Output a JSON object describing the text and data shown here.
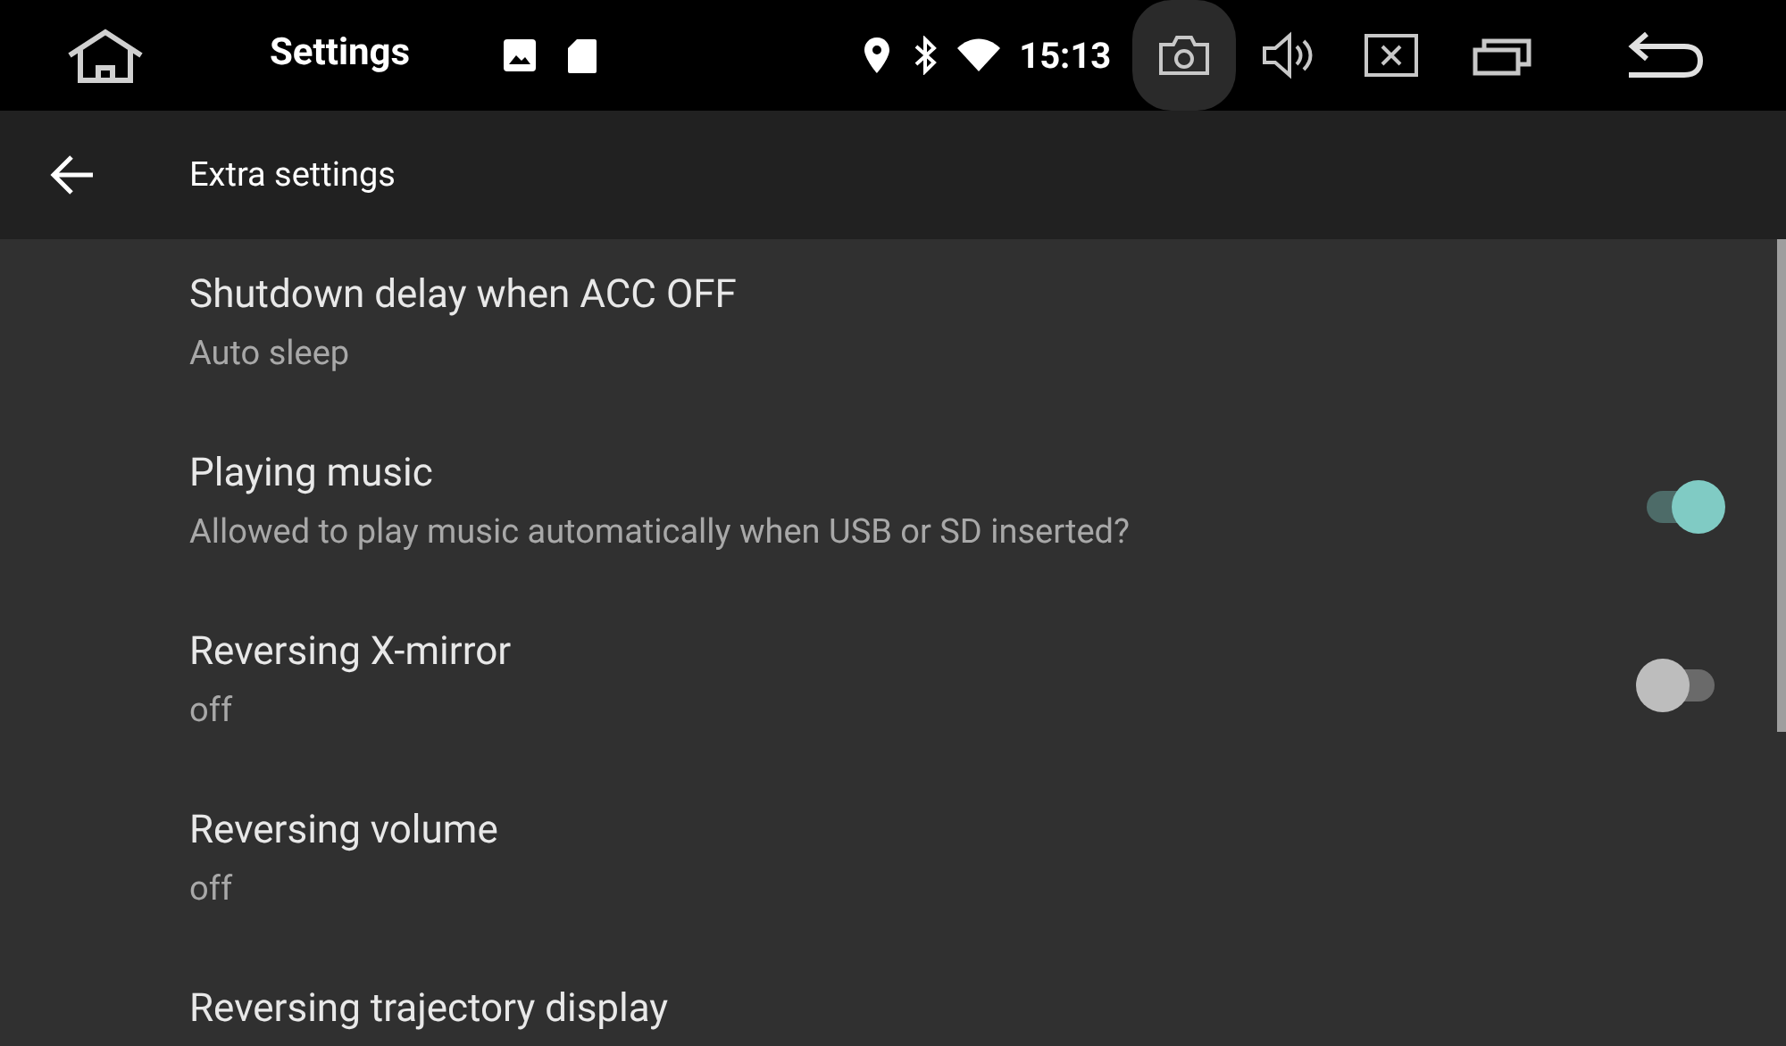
{
  "status_bar": {
    "app_title": "Settings",
    "time": "15:13"
  },
  "header": {
    "title": "Extra settings"
  },
  "items": [
    {
      "kind": "plain",
      "title": "Shutdown delay when ACC OFF",
      "summary": "Auto sleep"
    },
    {
      "kind": "toggle",
      "title": "Playing music",
      "summary": "Allowed to play music automatically when USB or SD inserted?",
      "on": true
    },
    {
      "kind": "toggle",
      "title": "Reversing X-mirror",
      "summary": "off",
      "on": false
    },
    {
      "kind": "plain",
      "title": "Reversing volume",
      "summary": "off"
    },
    {
      "kind": "plain",
      "title": "Reversing trajectory display"
    }
  ]
}
